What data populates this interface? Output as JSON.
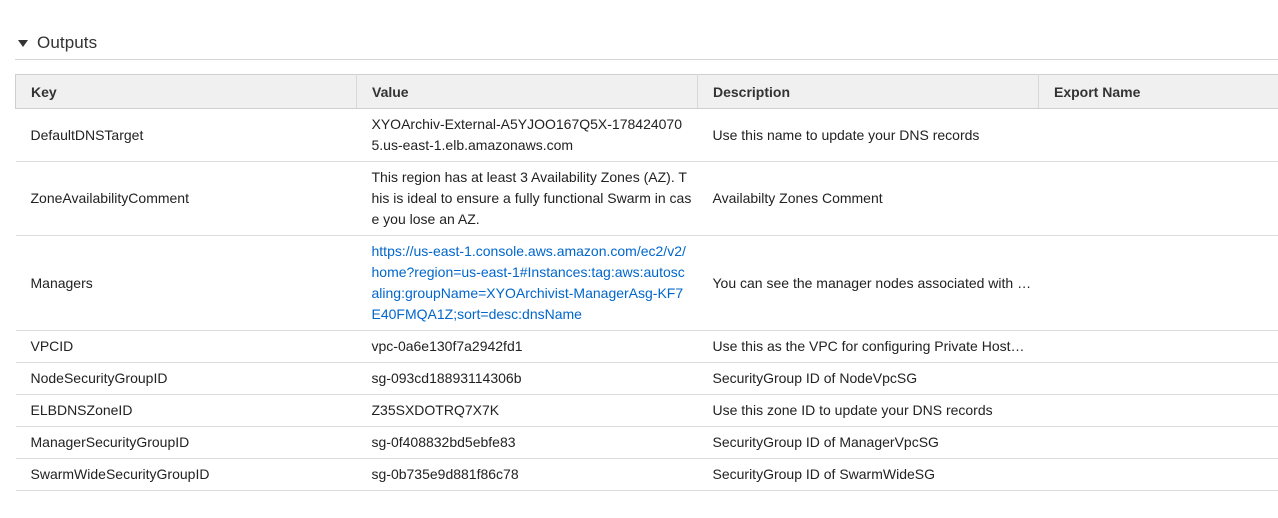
{
  "section": {
    "title": "Outputs",
    "expanded": true
  },
  "table": {
    "columns": [
      "Key",
      "Value",
      "Description",
      "Export Name"
    ],
    "rows": [
      {
        "key": "DefaultDNSTarget",
        "value": "XYOArchiv-External-A5YJOO167Q5X-1784240705.us-east-1.elb.amazonaws.com",
        "description": "Use this name to update your DNS records",
        "export_name": ""
      },
      {
        "key": "ZoneAvailabilityComment",
        "value": "This region has at least 3 Availability Zones (AZ). This is ideal to ensure a fully functional Swarm in case you lose an AZ.",
        "description": "Availabilty Zones Comment",
        "export_name": ""
      },
      {
        "key": "Managers",
        "value": "https://us-east-1.console.aws.amazon.com/ec2/v2/home?region=us-east-1#Instances:tag:aws:autoscaling:groupName=XYOArchivist-ManagerAsg-KF7E40FMQA1Z;sort=desc:dnsName",
        "description": "You can see the manager nodes associated with …",
        "export_name": ""
      },
      {
        "key": "VPCID",
        "value": "vpc-0a6e130f7a2942fd1",
        "description": "Use this as the VPC for configuring Private Host…",
        "export_name": ""
      },
      {
        "key": "NodeSecurityGroupID",
        "value": "sg-093cd18893114306b",
        "description": "SecurityGroup ID of NodeVpcSG",
        "export_name": ""
      },
      {
        "key": "ELBDNSZoneID",
        "value": "Z35SXDOTRQ7X7K",
        "description": "Use this zone ID to update your DNS records",
        "export_name": ""
      },
      {
        "key": "ManagerSecurityGroupID",
        "value": "sg-0f408832bd5ebfe83",
        "description": "SecurityGroup ID of ManagerVpcSG",
        "export_name": ""
      },
      {
        "key": "SwarmWideSecurityGroupID",
        "value": "sg-0b735e9d881f86c78",
        "description": "SecurityGroup ID of SwarmWideSG",
        "export_name": ""
      }
    ]
  },
  "colors": {
    "link": "#0066cc",
    "header_bg": "#f0f0f0",
    "text": "#222222"
  }
}
